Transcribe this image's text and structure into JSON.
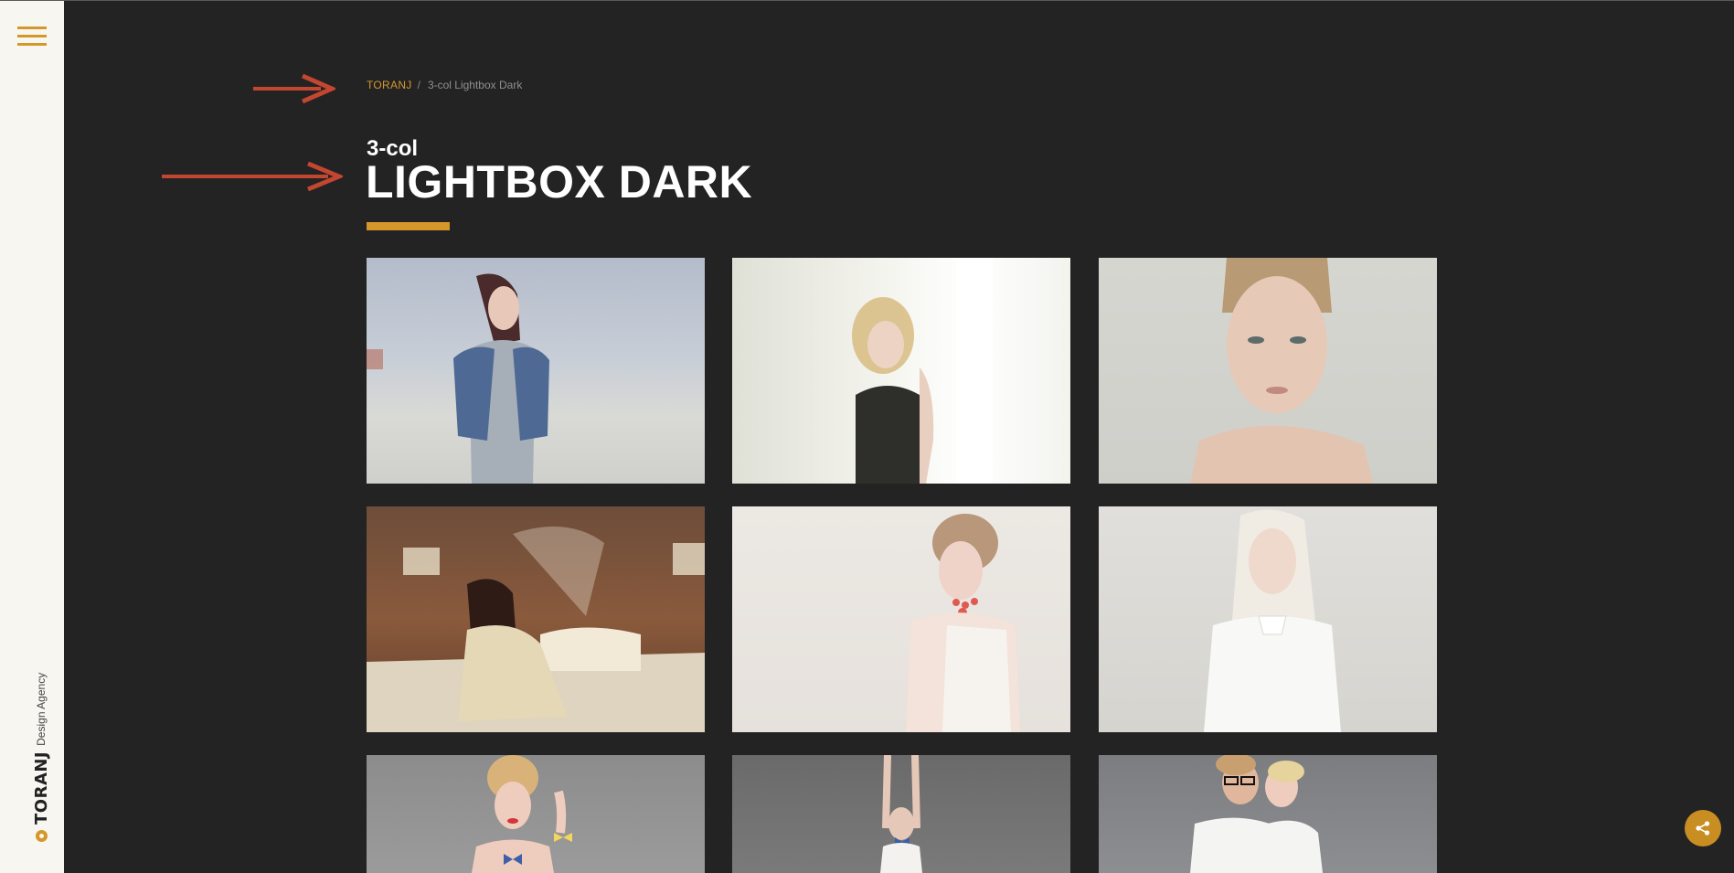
{
  "sidebar": {
    "brand": {
      "name": "TORANJ",
      "tagline": "Design Agency"
    }
  },
  "breadcrumb": {
    "home": "TORANJ",
    "separator": "/",
    "current": "3-col Lightbox Dark"
  },
  "page": {
    "subtitle": "3-col",
    "title": "LIGHTBOX DARK"
  },
  "gallery": {
    "items": [
      {
        "desc": "Woman in denim jacket by the sea"
      },
      {
        "desc": "Blonde woman with curls beside white wall"
      },
      {
        "desc": "Close-up portrait with slicked hair"
      },
      {
        "desc": "Woman in cream dress on bed"
      },
      {
        "desc": "Woman with coral necklace"
      },
      {
        "desc": "Platinum blonde in white shirt"
      },
      {
        "desc": "Woman with bow ties"
      },
      {
        "desc": "Woman with raised arms"
      },
      {
        "desc": "Couple in white t-shirts"
      }
    ]
  },
  "colors": {
    "accent": "#d4982a",
    "background": "#232323",
    "sidebar": "#f7f6f1",
    "annotation_arrow": "#c34630"
  },
  "icons": {
    "menu": "hamburger-icon",
    "share": "share-icon",
    "brand": "toranj-logo-icon"
  }
}
